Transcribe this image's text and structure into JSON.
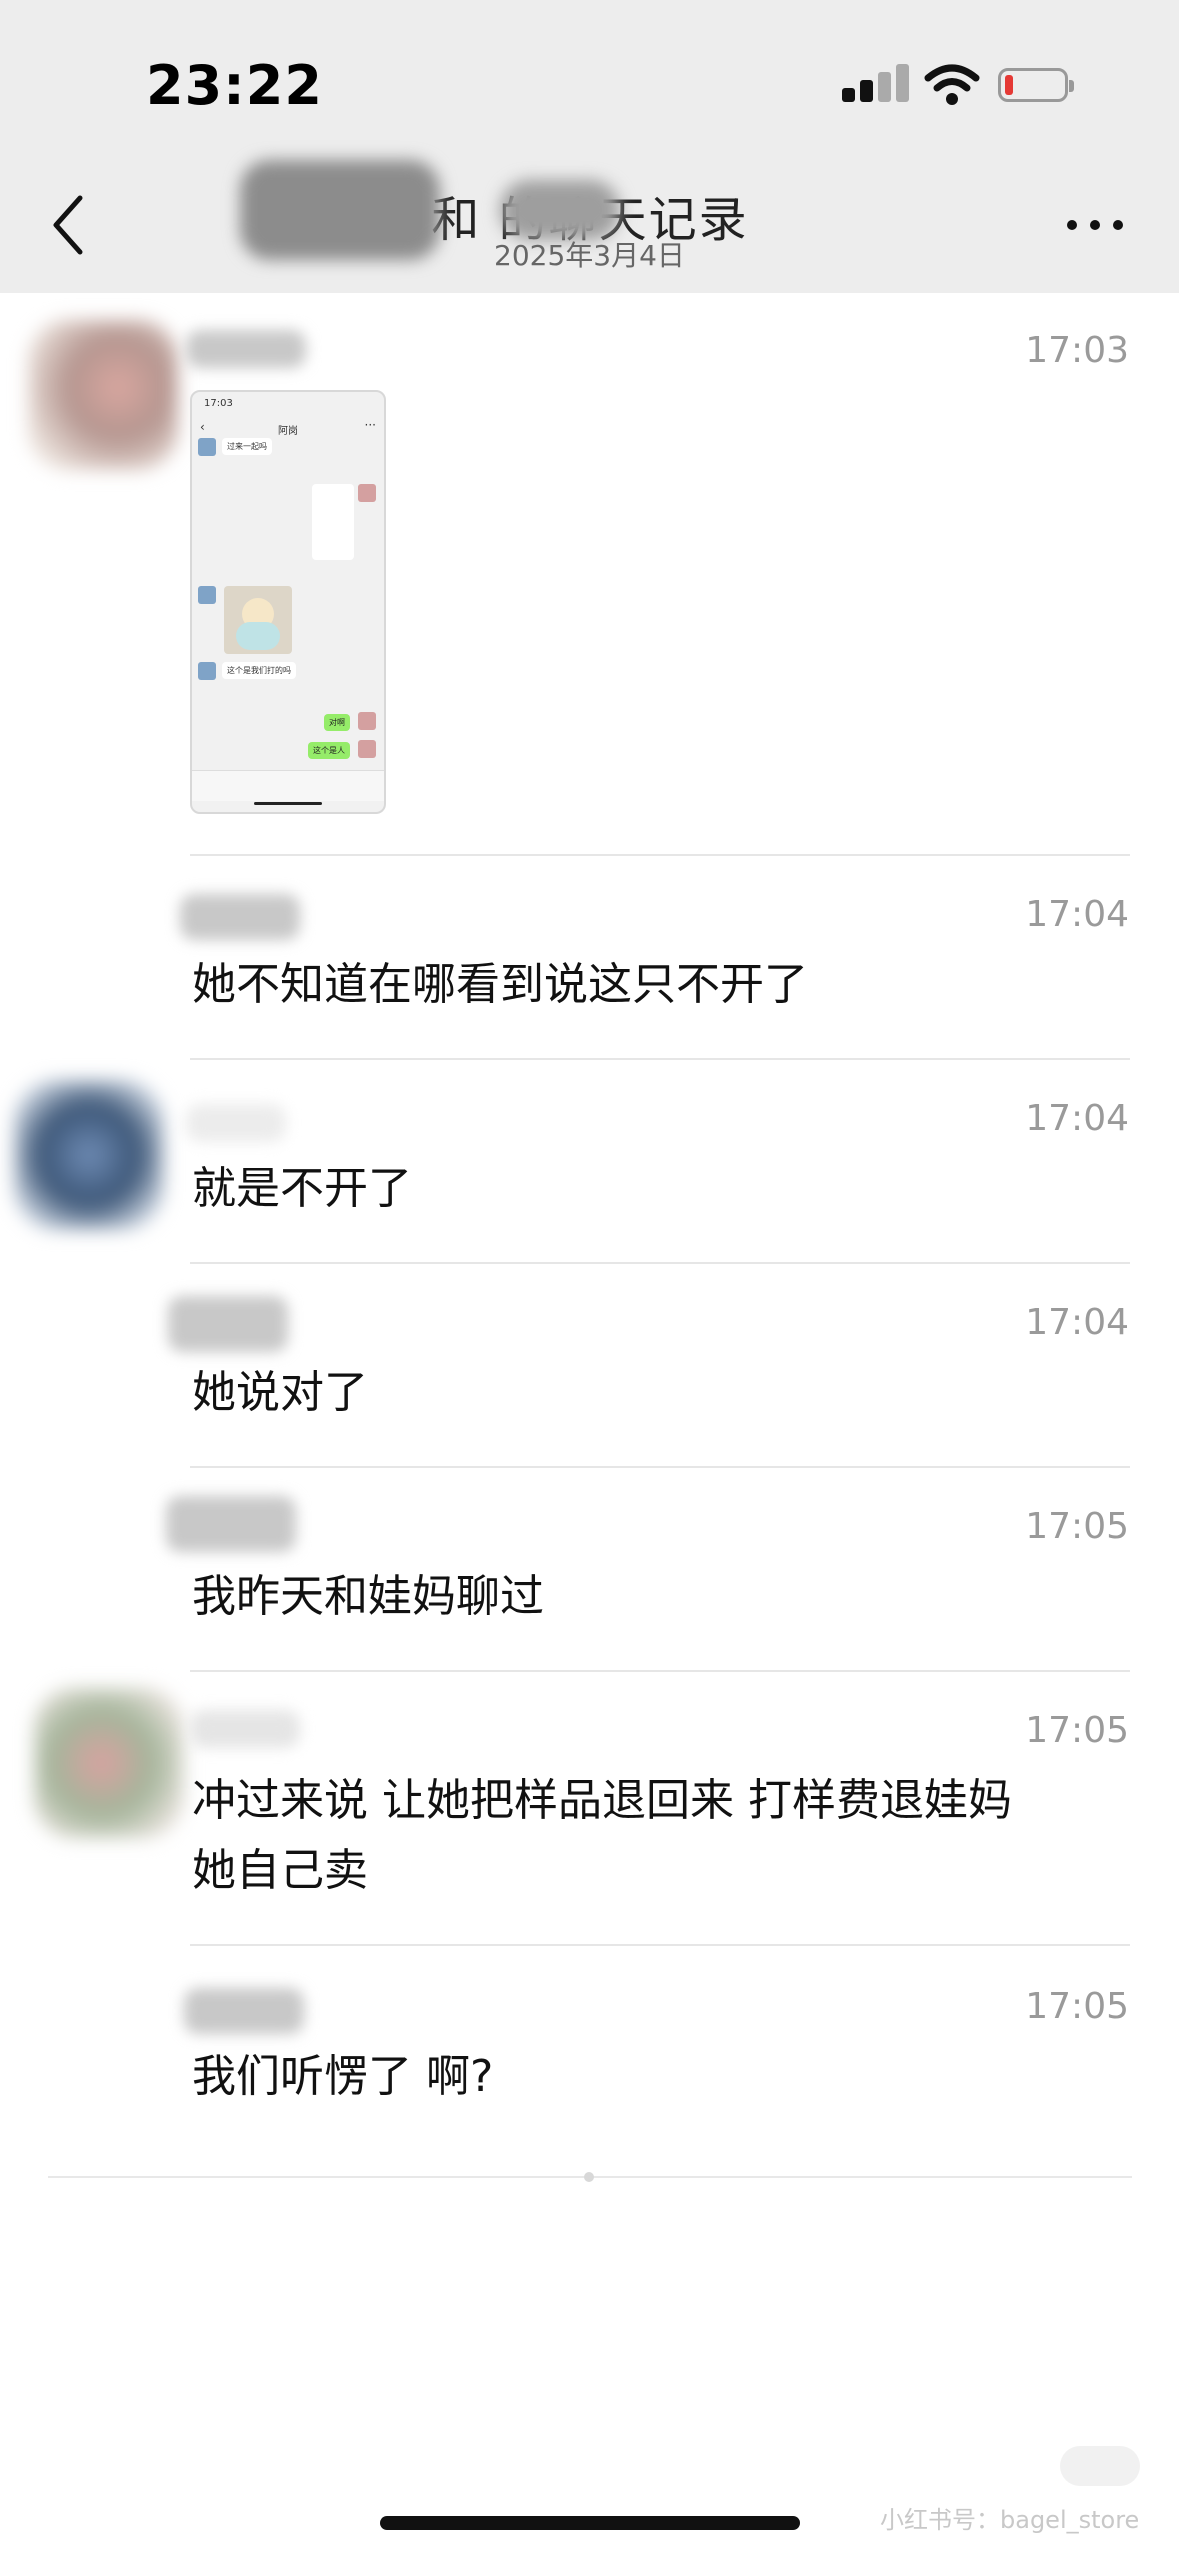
{
  "status_bar": {
    "time": "23:22"
  },
  "nav": {
    "title_suffix": "和      的聊天记录",
    "date": "2025年3月4日"
  },
  "thumbnail": {
    "status_time": "17:03",
    "title": "阿岗",
    "msg1": "过来一起吗",
    "msg2": "这个是我们打的吗",
    "reply1": "对啊",
    "reply2": "这个是人"
  },
  "messages": [
    {
      "time": "17:03",
      "text": ""
    },
    {
      "time": "17:04",
      "text": "她不知道在哪看到说这只不开了"
    },
    {
      "time": "17:04",
      "text": "就是不开了"
    },
    {
      "time": "17:04",
      "text": "她说对了"
    },
    {
      "time": "17:05",
      "text": "我昨天和娃妈聊过"
    },
    {
      "time": "17:05",
      "line1": "冲过来说 让她把样品退回来 打样费退娃妈",
      "line2": "她自己卖"
    },
    {
      "time": "17:05",
      "text": "我们听愣了 啊?"
    }
  ],
  "watermark": "小红书号：bagel_store",
  "colors": {
    "header_bg": "#ededed",
    "divider": "#e6e6e6",
    "time_gray": "#9a9a9a",
    "battery_low": "#e53935"
  }
}
